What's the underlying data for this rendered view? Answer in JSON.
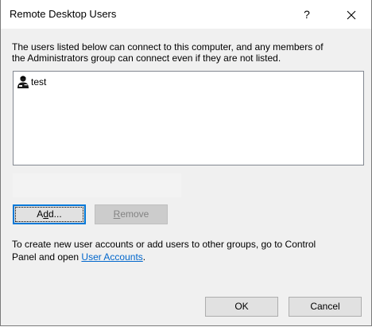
{
  "window": {
    "title": "Remote Desktop Users",
    "help_label": "?"
  },
  "description": {
    "line1": "The users listed below can connect to this computer, and any members of",
    "line2": "the Administrators group can connect even if they are not listed."
  },
  "users": [
    {
      "name": "test",
      "icon": "user-icon"
    }
  ],
  "buttons": {
    "add": {
      "pre": "A",
      "accel": "d",
      "post": "d..."
    },
    "remove": {
      "pre": "",
      "accel": "R",
      "post": "emove"
    },
    "ok": "OK",
    "cancel": "Cancel"
  },
  "info": {
    "text_line1": "To create new user accounts or add users to other groups, go to Control",
    "text_line2_prefix": "Panel and open ",
    "link_label": "User Accounts",
    "text_line2_suffix": "."
  },
  "colors": {
    "accent": "#0078d7",
    "link": "#0066cc"
  }
}
